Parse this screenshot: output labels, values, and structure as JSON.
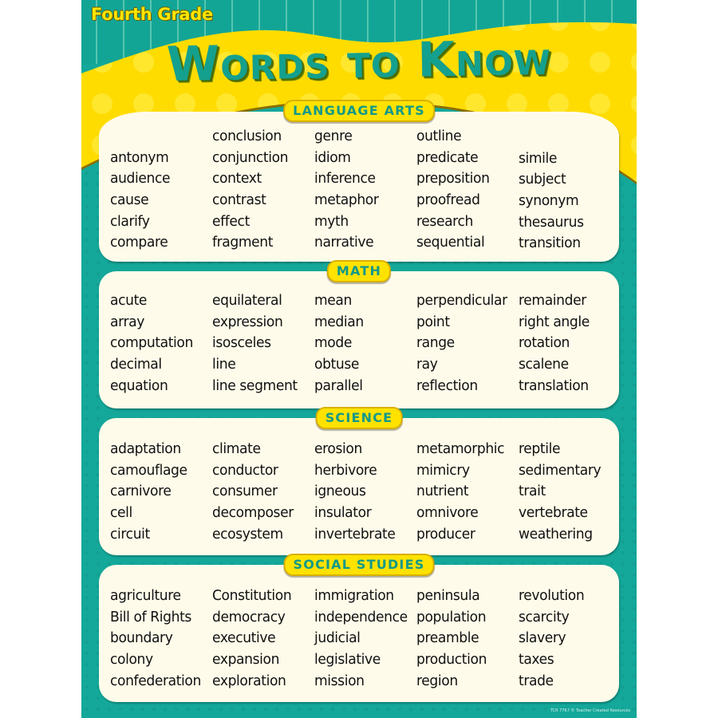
{
  "header": {
    "grade": "Fourth Grade",
    "title": "Words to Know"
  },
  "colors": {
    "teal": "#14a89a",
    "yellow": "#ffe200",
    "panel": "#fffbea",
    "text": "#111111"
  },
  "sections": [
    {
      "label": "LANGUAGE ARTS",
      "columns": [
        [
          "",
          "antonym",
          "audience",
          "cause",
          "clarify",
          "compare"
        ],
        [
          "conclusion",
          "conjunction",
          "context",
          "contrast",
          "effect",
          "fragment"
        ],
        [
          "genre",
          "idiom",
          "inference",
          "metaphor",
          "myth",
          "narrative"
        ],
        [
          "outline",
          "predicate",
          "preposition",
          "proofread",
          "research",
          "sequential"
        ],
        [
          "",
          "simile",
          "subject",
          "synonym",
          "thesaurus",
          "transition"
        ]
      ]
    },
    {
      "label": "MATH",
      "columns": [
        [
          "acute",
          "array",
          "computation",
          "decimal",
          "equation"
        ],
        [
          "equilateral",
          "expression",
          "isosceles",
          "line",
          "line segment"
        ],
        [
          "mean",
          "median",
          "mode",
          "obtuse",
          "parallel"
        ],
        [
          "perpendicular",
          "point",
          "range",
          "ray",
          "reflection"
        ],
        [
          "remainder",
          "right angle",
          "rotation",
          "scalene",
          "translation"
        ]
      ]
    },
    {
      "label": "SCIENCE",
      "columns": [
        [
          "adaptation",
          "camouflage",
          "carnivore",
          "cell",
          "circuit"
        ],
        [
          "climate",
          "conductor",
          "consumer",
          "decomposer",
          "ecosystem"
        ],
        [
          "erosion",
          "herbivore",
          "igneous",
          "insulator",
          "invertebrate"
        ],
        [
          "metamorphic",
          "mimicry",
          "nutrient",
          "omnivore",
          "producer"
        ],
        [
          "reptile",
          "sedimentary",
          "trait",
          "vertebrate",
          "weathering"
        ]
      ]
    },
    {
      "label": "SOCIAL STUDIES",
      "columns": [
        [
          "agriculture",
          "Bill of Rights",
          "boundary",
          "colony",
          "confederation"
        ],
        [
          "Constitution",
          "democracy",
          "executive",
          "expansion",
          "exploration"
        ],
        [
          "immigration",
          "independence",
          "judicial",
          "legislative",
          "mission"
        ],
        [
          "peninsula",
          "population",
          "preamble",
          "production",
          "region"
        ],
        [
          "revolution",
          "scarcity",
          "slavery",
          "taxes",
          "trade"
        ]
      ]
    }
  ],
  "footer": "TCR 7767 © Teacher Created Resources"
}
